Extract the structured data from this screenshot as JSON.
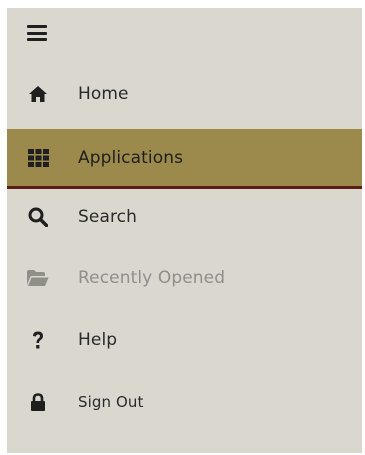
{
  "nav": {
    "menu_icon": "hamburger-icon",
    "items": [
      {
        "label": "Home",
        "icon": "home-icon",
        "state": "normal"
      },
      {
        "label": "Applications",
        "icon": "grid-icon",
        "state": "active"
      },
      {
        "label": "Search",
        "icon": "search-icon",
        "state": "normal"
      },
      {
        "label": "Recently Opened",
        "icon": "folder-open-icon",
        "state": "disabled"
      },
      {
        "label": "Help",
        "icon": "question-icon",
        "state": "normal"
      },
      {
        "label": "Sign Out",
        "icon": "lock-icon",
        "state": "normal"
      }
    ]
  },
  "colors": {
    "panel_background": "#d9d7ce",
    "active_background": "#9c8a4c",
    "active_border": "#5a1e14",
    "disabled_text": "#8f8e88"
  }
}
